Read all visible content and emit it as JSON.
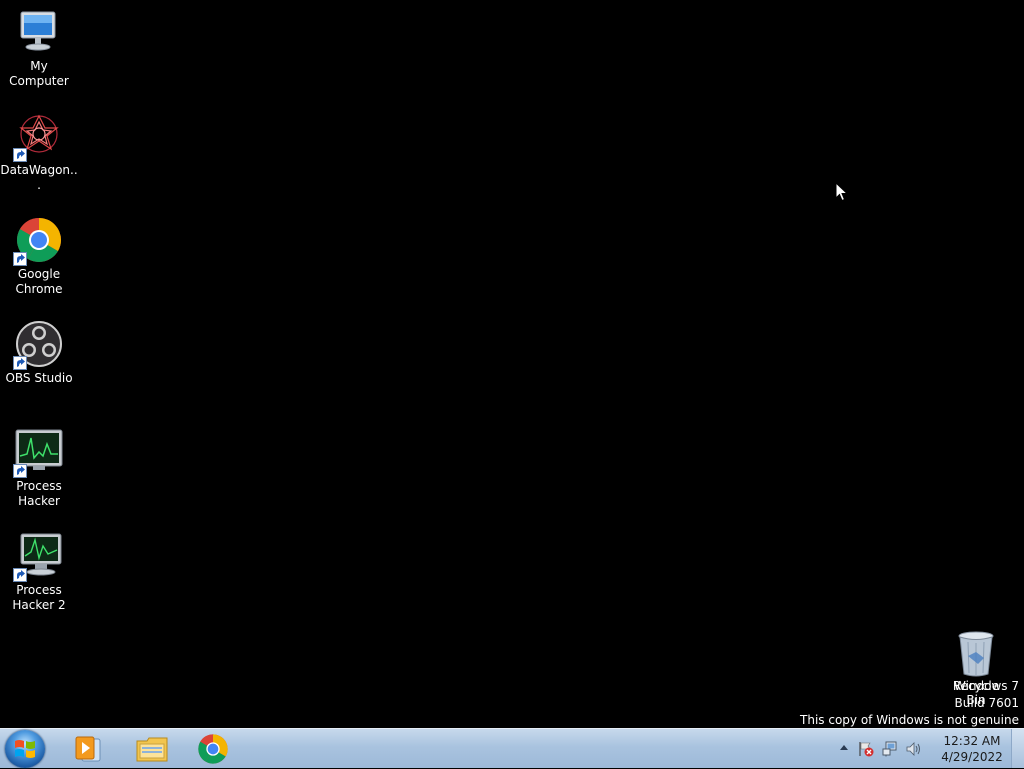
{
  "desktop": {
    "icons": [
      {
        "label": "My Computer",
        "icon": "computer-icon"
      },
      {
        "label": "DataWagon...",
        "icon": "datawagon-icon"
      },
      {
        "label": "Google Chrome",
        "icon": "chrome-icon"
      },
      {
        "label": "OBS Studio",
        "icon": "obs-icon"
      },
      {
        "label": "Process Hacker",
        "icon": "process-hacker-icon"
      },
      {
        "label": "Process Hacker 2",
        "icon": "process-hacker-2-icon"
      }
    ],
    "recycle_bin": {
      "label": "Recycle Bin",
      "icon": "recycle-bin-icon"
    }
  },
  "watermark": {
    "line1": "Windows 7",
    "line2": "Build 7601",
    "line3": "This copy of Windows is not genuine"
  },
  "taskbar": {
    "start_icon": "windows-logo-icon",
    "pinned": [
      {
        "name": "Windows Media Player",
        "icon": "media-player-icon"
      },
      {
        "name": "Windows Explorer",
        "icon": "file-explorer-icon"
      },
      {
        "name": "Google Chrome",
        "icon": "chrome-icon"
      }
    ],
    "tray": {
      "icons": [
        "show-hidden-icons-arrow",
        "action-center-flag-icon",
        "network-icon",
        "volume-icon"
      ],
      "time": "12:32 AM",
      "date": "4/29/2022"
    }
  },
  "colors": {
    "desktop_bg": "#000000",
    "taskbar_top": "#c7d9ec",
    "taskbar_bottom": "#9db9d8"
  }
}
